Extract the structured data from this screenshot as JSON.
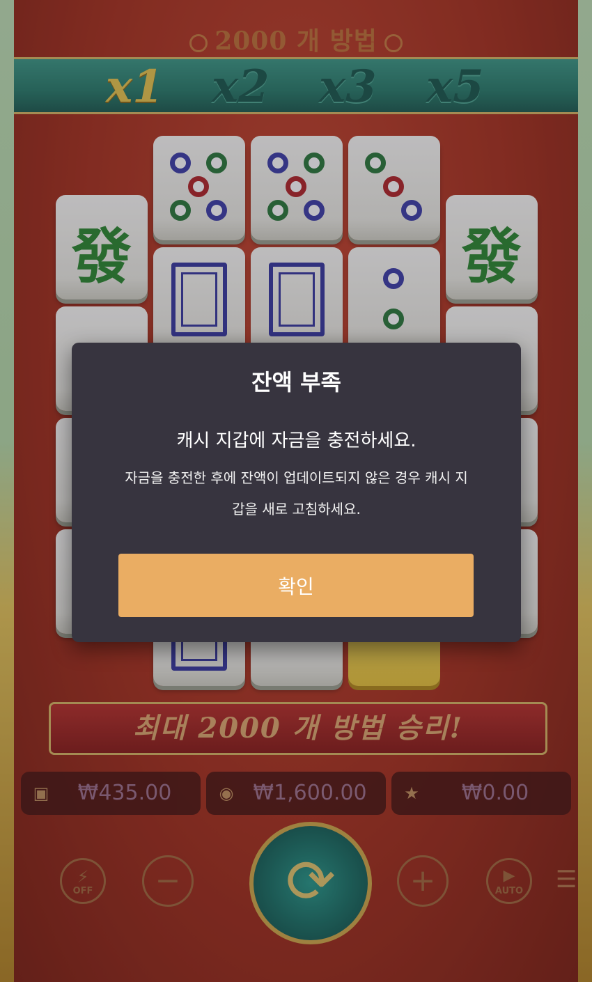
{
  "game": {
    "top_caption": "2000 개 방법",
    "multipliers": [
      "x1",
      "x2",
      "x3",
      "x5"
    ],
    "active_multiplier": "x1",
    "banner_text": "최대 2000 개 방법 승리!",
    "tile_glyph_green_dragon": "發"
  },
  "stats": {
    "balance": "₩435.00",
    "bet": "₩1,600.00",
    "win": "₩0.00",
    "balance_icon": "wallet-icon",
    "bet_icon": "coins-icon",
    "win_icon": "win-icon"
  },
  "controls": {
    "turbo_label": "OFF",
    "auto_label": "AUTO",
    "minus_glyph": "−",
    "plus_glyph": "+",
    "spin_glyph": "⟳",
    "menu_glyph": "☰"
  },
  "dialog": {
    "title": "잔액 부족",
    "message": "캐시 지갑에 자금을 충전하세요.",
    "note": "자금을 충전한 후에 잔액이 업데이트되지 않은 경우 캐시 지갑을 새로 고침하세요.",
    "confirm_label": "확인"
  }
}
